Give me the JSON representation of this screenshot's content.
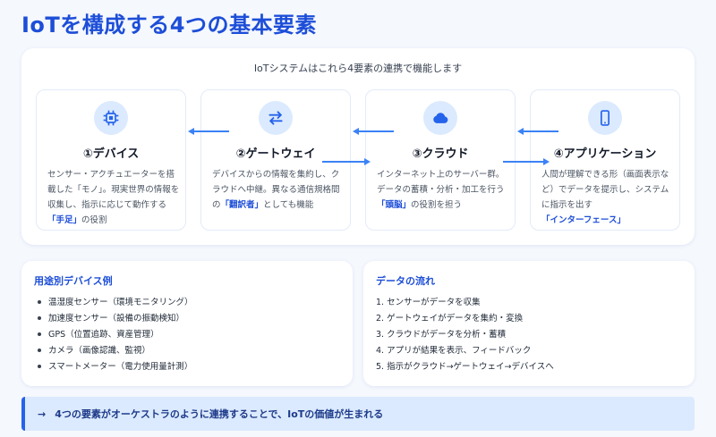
{
  "title": "IoTを構成する4つの基本要素",
  "overview_caption": "IoTシステムはこれら4要素の連携で機能します",
  "elements": [
    {
      "title": "①デバイス",
      "icon": "chip-icon",
      "desc_before": "センサー・アクチュエーターを搭載した「モノ」。現実世界の情報を収集し、指示に応じて動作する",
      "desc_em": "「手足」",
      "desc_after": "の役割"
    },
    {
      "title": "②ゲートウェイ",
      "icon": "exchange-arrows-icon",
      "desc_before": "デバイスからの情報を集約し、クラウドへ中継。異なる通信規格間の",
      "desc_em": "「翻訳者」",
      "desc_after": "としても機能"
    },
    {
      "title": "③クラウド",
      "icon": "cloud-icon",
      "desc_before": "インターネット上のサーバー群。データの蓄積・分析・加工を行う",
      "desc_em": "「頭脳」",
      "desc_after": "の役割を担う"
    },
    {
      "title": "④アプリケーション",
      "icon": "smartphone-icon",
      "desc_before": "人間が理解できる形（画面表示など）でデータを提示し、システムに指示を出す",
      "desc_em": "「インターフェース」",
      "desc_after": ""
    }
  ],
  "devices_panel": {
    "title": "用途別デバイス例",
    "items": [
      "温湿度センサー（環境モニタリング）",
      "加速度センサー（設備の振動検知）",
      "GPS（位置追跡、資産管理）",
      "カメラ（画像認識、監視）",
      "スマートメーター（電力使用量計測）"
    ]
  },
  "flow_panel": {
    "title": "データの流れ",
    "items": [
      "1. センサーがデータを収集",
      "2. ゲートウェイがデータを集約・変換",
      "3. クラウドがデータを分析・蓄積",
      "4. アプリが結果を表示、フィードバック",
      "5. 指示がクラウド→ゲートウェイ→デバイスへ"
    ]
  },
  "summary": {
    "arrow": "→",
    "text": "4つの要素がオーケストラのように連携することで、IoTの価値が生まれる"
  },
  "colors": {
    "accent": "#1d4ed8",
    "icon_bg": "#dbeafe",
    "arrow": "#3b82f6"
  }
}
